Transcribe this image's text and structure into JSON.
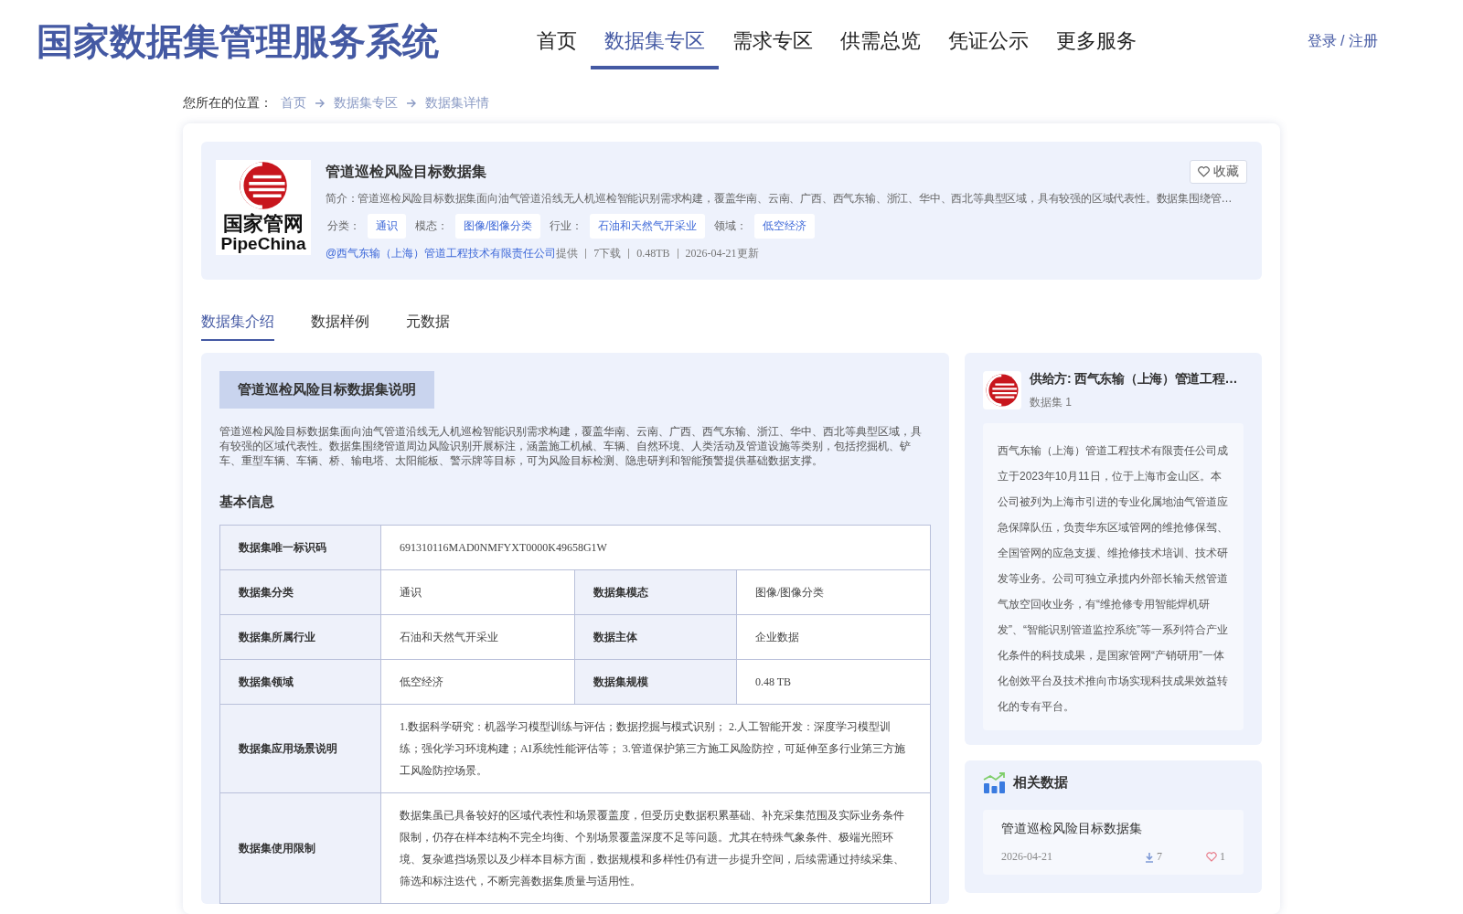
{
  "header": {
    "title": "国家数据集管理服务系统",
    "nav": [
      {
        "label": "首页",
        "selected": false
      },
      {
        "label": "数据集专区",
        "selected": true
      },
      {
        "label": "需求专区",
        "selected": false
      },
      {
        "label": "供需总览",
        "selected": false
      },
      {
        "label": "凭证公示",
        "selected": false
      },
      {
        "label": "更多服务",
        "selected": false
      }
    ],
    "login": "登录 / 注册"
  },
  "breadcrumb": {
    "prefix": "您所在的位置：",
    "items": [
      "首页",
      "数据集专区",
      "数据集详情"
    ]
  },
  "dataset": {
    "logo_lines": [
      "国家管网",
      "PipeChina"
    ],
    "title": "管道巡检风险目标数据集",
    "favorite": "收藏",
    "summary": "简介：管道巡检风险目标数据集面向油气管道沿线无人机巡检智能识别需求构建，覆盖华南、云南、广西、西气东输、浙江、华中、西北等典型区域，具有较强的区域代表性。数据集围绕管…",
    "tags": [
      {
        "label": "分类：",
        "value": "通识"
      },
      {
        "label": "模态：",
        "value": "图像/图像分类"
      },
      {
        "label": "行业：",
        "value": "石油和天然气开采业"
      },
      {
        "label": "领域：",
        "value": "低空经济"
      }
    ],
    "provider": "@西气东输（上海）管道工程技术有限责任公司",
    "provider_suffix": "提供",
    "stats": [
      "7下载",
      "0.48TB",
      "2026-04-21更新"
    ]
  },
  "tabs": [
    {
      "label": "数据集介绍",
      "selected": true
    },
    {
      "label": "数据样例",
      "selected": false
    },
    {
      "label": "元数据",
      "selected": false
    }
  ],
  "intro": {
    "heading": "管道巡检风险目标数据集说明",
    "text": "管道巡检风险目标数据集面向油气管道沿线无人机巡检智能识别需求构建，覆盖华南、云南、广西、西气东输、浙江、华中、西北等典型区域，具有较强的区域代表性。数据集围绕管道周边风险识别开展标注，涵盖施工机械、车辆、自然环境、人类活动及管道设施等类别，包括挖掘机、铲车、重型车辆、车辆、桥、输电塔、太阳能板、警示牌等目标，可为风险目标检测、隐患研判和智能预警提供基础数据支撑。",
    "section_title": "基本信息",
    "rows": [
      {
        "kind": "wide",
        "cells": [
          {
            "label": "数据集唯一标识码",
            "value": "691310116MAD0NMFYXT0000K49658G1W"
          }
        ]
      },
      {
        "kind": "pair",
        "cells": [
          {
            "label": "数据集分类",
            "value": "通识"
          },
          {
            "label": "数据集模态",
            "value": "图像/图像分类"
          }
        ]
      },
      {
        "kind": "pair",
        "cells": [
          {
            "label": "数据集所属行业",
            "value": "石油和天然气开采业"
          },
          {
            "label": "数据主体",
            "value": "企业数据"
          }
        ]
      },
      {
        "kind": "pair",
        "cells": [
          {
            "label": "数据集领域",
            "value": "低空经济"
          },
          {
            "label": "数据集规模",
            "value": "0.48 TB"
          }
        ]
      },
      {
        "kind": "wide",
        "cells": [
          {
            "label": "数据集应用场景说明",
            "value": "1.数据科学研究：机器学习模型训练与评估；数据挖掘与模式识别； 2.人工智能开发：深度学习模型训练；强化学习环境构建；AI系统性能评估等； 3.管道保护第三方施工风险防控，可延伸至多行业第三方施工风险防控场景。"
          }
        ]
      },
      {
        "kind": "wide",
        "cells": [
          {
            "label": "数据集使用限制",
            "value": "数据集虽已具备较好的区域代表性和场景覆盖度，但受历史数据积累基础、补充采集范围及实际业务条件限制，仍存在样本结构不完全均衡、个别场景覆盖深度不足等问题。尤其在特殊气象条件、极端光照环境、复杂遮挡场景以及少样本目标方面，数据规模和多样性仍有进一步提升空间，后续需通过持续采集、筛选和标注迭代，不断完善数据集质量与适用性。"
          }
        ]
      }
    ]
  },
  "supplier": {
    "name": "供给方: 西气东输（上海）管道工程…",
    "count": "数据集 1",
    "description": "西气东输（上海）管道工程技术有限责任公司成立于2023年10月11日，位于上海市金山区。本公司被列为上海市引进的专业化属地油气管道应急保障队伍，负责华东区域管网的维抢修保驾、全国管网的应急支援、维抢修技术培训、技术研发等业务。公司可独立承揽内外部长输天然管道气放空回收业务，有“维抢修专用智能焊机研发”、“智能识别管道监控系统”等一系列符合产业化条件的科技成果，是国家管网“产销研用”一体化创效平台及技术推向市场实现科技成果效益转化的专有平台。"
  },
  "related": {
    "title": "相关数据",
    "items": [
      {
        "title": "管道巡检风险目标数据集",
        "date": "2026-04-21",
        "downloads": "7",
        "likes": "1"
      }
    ]
  }
}
